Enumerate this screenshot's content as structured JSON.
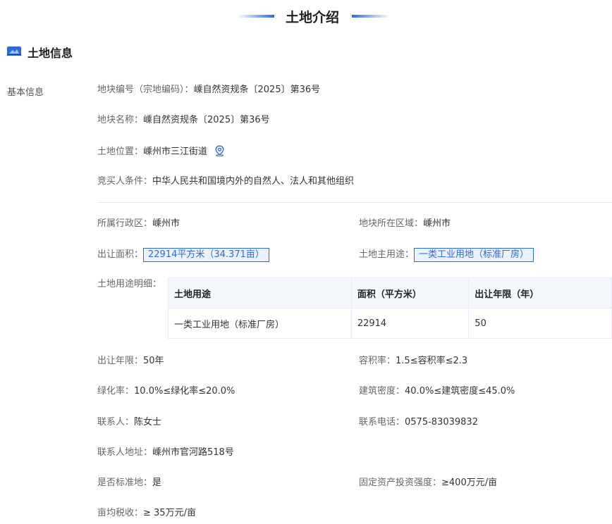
{
  "header": {
    "title": "土地介绍"
  },
  "section": {
    "title": "土地信息",
    "side_label": "基本信息"
  },
  "basic": {
    "parcel_code_label": "地块编号（宗地编码）：",
    "parcel_code": "嵊自然资规条〔2025〕第36号",
    "parcel_name_label": "地块名称：",
    "parcel_name": "嵊自然资规条〔2025〕第36号",
    "location_label": "土地位置：",
    "location": "嵊州市三江街道",
    "bidder_label": "竞买人条件：",
    "bidder": "中华人民共和国境内外的自然人、法人和其他组织"
  },
  "details": {
    "admin_region_label": "所属行政区：",
    "admin_region": "嵊州市",
    "parcel_region_label": "地块所在区域：",
    "parcel_region": "嵊州市",
    "area_label": "出让面积：",
    "area": "22914平方米（34.371亩）",
    "main_use_label": "土地主用途：",
    "main_use": "一类工业用地（标准厂房）",
    "use_detail_label": "土地用途明细：",
    "term_label": "出让年限：",
    "term": "50年",
    "far_label": "容积率：",
    "far": "1.5≤容积率≤2.3",
    "green_label": "绿化率：",
    "green": "10.0%≤绿化率≤20.0%",
    "density_label": "建筑密度：",
    "density": "40.0%≤建筑密度≤45.0%",
    "contact_label": "联系人：",
    "contact": "陈女士",
    "phone_label": "联系电话：",
    "phone": "0575-83039832",
    "address_label": "联系人地址：",
    "address": "嵊州市官河路518号",
    "standard_label": "是否标准地：",
    "standard": "是",
    "invest_label": "固定资产投资强度：",
    "invest": "≥400万元/亩",
    "tax_label": "亩均税收：",
    "tax": "≥ 35万元/亩"
  },
  "use_table": {
    "headers": [
      "土地用途",
      "面积（平方米）",
      "出让年限（年）"
    ],
    "row": [
      "一类工业用地（标准厂房）",
      "22914",
      "50"
    ]
  },
  "colors": {
    "accent": "#2e6bd8",
    "boxed_bg": "#eaf2ff"
  }
}
